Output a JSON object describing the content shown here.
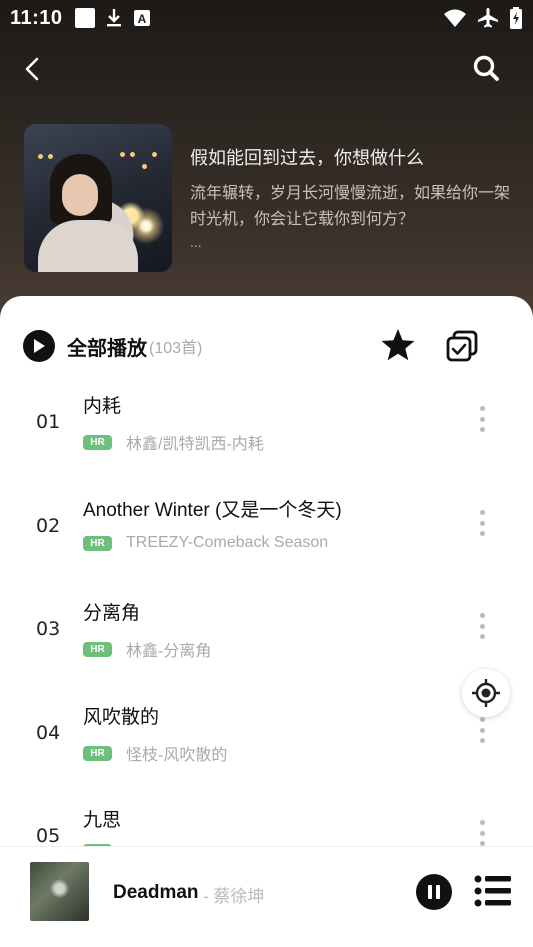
{
  "status_bar": {
    "time": "11:10",
    "icons": [
      "square-icon",
      "download-icon",
      "font-icon",
      "wifi-icon",
      "airplane-icon",
      "battery-charging-icon"
    ]
  },
  "nav": {
    "back_icon": "chevron-left-icon",
    "search_icon": "search-icon"
  },
  "playlist": {
    "title": "假如能回到过去，你想做什么",
    "description": "流年辗转，岁月长河慢慢流逝，如果给你一架时光机，你会让它载你到何方？",
    "more": "..."
  },
  "sheet": {
    "play_all_label": "全部播放",
    "count": "(103首)",
    "favorite_icon": "star-icon",
    "multi_select_icon": "multi-select-icon"
  },
  "songs": [
    {
      "num": "01",
      "title": "内耗",
      "badge": "HR",
      "artist": "林鑫/凯特凯西-内耗"
    },
    {
      "num": "02",
      "title": "Another Winter (又是一个冬天)",
      "badge": "HR",
      "artist": "TREEZY-Comeback Season"
    },
    {
      "num": "03",
      "title": "分离角",
      "badge": "HR",
      "artist": "林鑫-分离角"
    },
    {
      "num": "04",
      "title": "风吹散的",
      "badge": "HR",
      "artist": "怪枝-风吹散的"
    },
    {
      "num": "05",
      "title": "九思",
      "badge": "HR",
      "artist": ""
    }
  ],
  "mini_player": {
    "title": "Deadman",
    "artist": " - 蔡徐坤",
    "pause_icon": "pause-icon",
    "queue_icon": "playlist-icon"
  },
  "colors": {
    "accent_badge": "#6cc07b",
    "hero_dark": "#1c1917",
    "hero_light": "#4a3d33"
  }
}
